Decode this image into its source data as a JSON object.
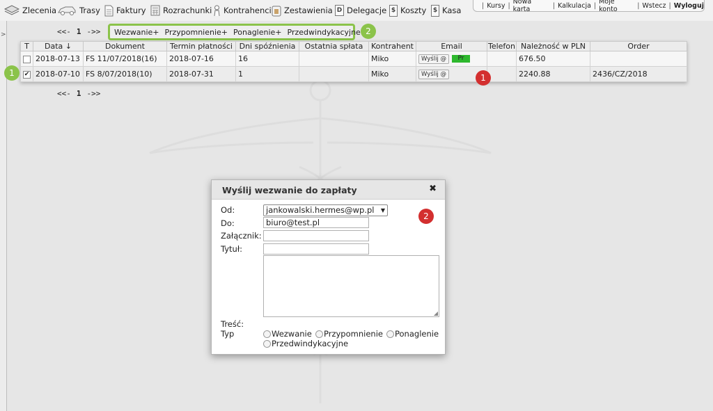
{
  "nav": {
    "items": [
      {
        "label": "Zlecenia",
        "icon": "stack-icon"
      },
      {
        "label": "Trasy",
        "icon": "car-icon"
      },
      {
        "label": "Faktury",
        "icon": "document-icon"
      },
      {
        "label": "Rozrachunki",
        "icon": "calculator-icon"
      },
      {
        "label": "Kontrahenci",
        "icon": "person-icon"
      },
      {
        "label": "Zestawienia",
        "icon": "report-icon"
      },
      {
        "label": "Delegacje",
        "icon": "d-icon"
      },
      {
        "label": "Koszty",
        "icon": "dollar-icon"
      },
      {
        "label": "Kasa",
        "icon": "dollar-icon"
      }
    ],
    "right_links": [
      "Kursy",
      "Nowa karta",
      "Kalkulacja",
      "Moje konto",
      "Wstecz"
    ],
    "logout_label": "Wyloguj",
    "separator": "|"
  },
  "left_strip": {
    "arrow": ">"
  },
  "pagination": {
    "prev": "<<-",
    "page": "1",
    "next": "->>"
  },
  "quick_links": [
    "Wezwanie+",
    "Przypomnienie+",
    "Ponaglenie+",
    "Przedwindykacyjne+"
  ],
  "badges": {
    "green_1": "1",
    "green_2": "2",
    "red_1": "1",
    "red_2": "2"
  },
  "table": {
    "columns": [
      "T",
      "Data ↓",
      "Dokument",
      "Termin płatności",
      "Dni spóźnienia",
      "Ostatnia spłata",
      "Kontrahent",
      "Email",
      "Telefon",
      "Należność w PLN",
      "Order"
    ],
    "rows": [
      {
        "checked": false,
        "data": "2018-07-13",
        "dokument": "FS 11/07/2018(16)",
        "termin": "2018-07-16",
        "dni": "16",
        "ostatnia": "",
        "kontrahent": "Miko",
        "send": "Wyślij @",
        "tag": "Pr",
        "telefon": "",
        "naleznosc": "676.50",
        "order": ""
      },
      {
        "checked": true,
        "data": "2018-07-10",
        "dokument": "FS 8/07/2018(10)",
        "termin": "2018-07-31",
        "dni": "1",
        "ostatnia": "",
        "kontrahent": "Miko",
        "send": "Wyślij @",
        "tag": "",
        "telefon": "",
        "naleznosc": "2240.88",
        "order": "2436/CZ/2018"
      }
    ]
  },
  "modal": {
    "title": "Wyślij wezwanie do zapłaty",
    "close": "✖",
    "labels": {
      "from": "Od:",
      "to": "Do:",
      "attachment": "Załącznik:",
      "subject": "Tytuł:",
      "body": "Treść:",
      "type": "Typ"
    },
    "from_value": "jankowalski.hermes@wp.pl",
    "to_value": "biuro@test.pl",
    "attachment_value": "",
    "subject_value": "",
    "types": [
      "Wezwanie",
      "Przypomnienie",
      "Ponaglenie",
      "Przedwindykacyjne"
    ]
  },
  "colors": {
    "green": "#8bc34a",
    "red": "#d32f2f",
    "tag_green": "#2eb82e"
  }
}
